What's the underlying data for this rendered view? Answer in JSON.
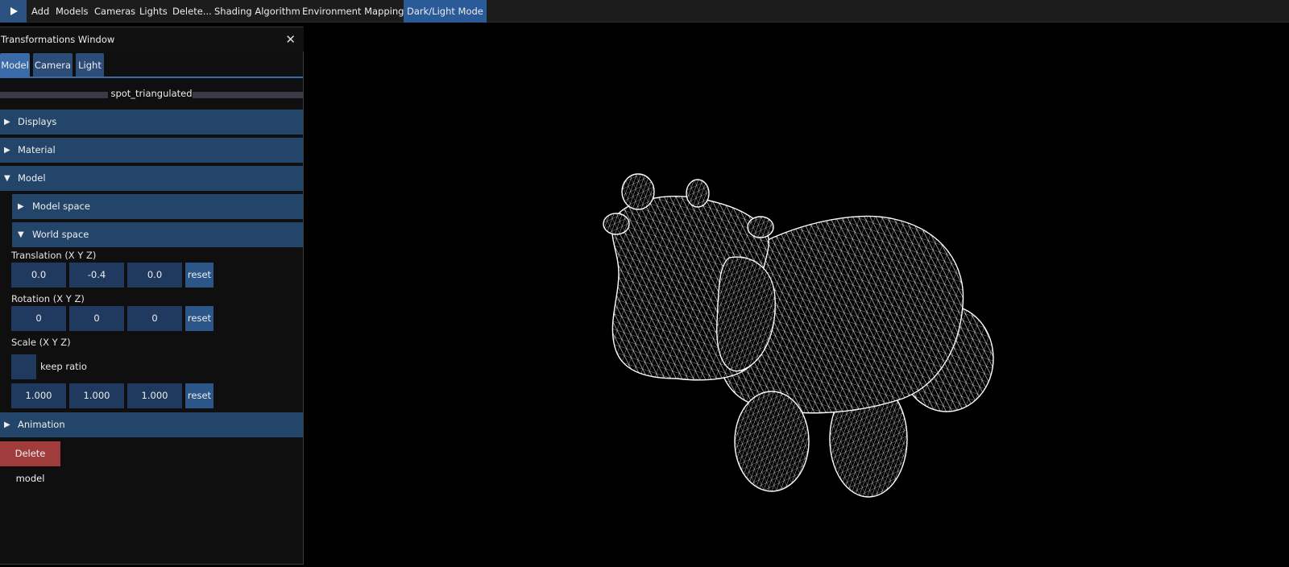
{
  "menubar": {
    "items": [
      "Add",
      "Models",
      "Cameras",
      "Lights",
      "Delete...",
      "Shading Algorithm",
      "Environment Mapping",
      "Dark/Light Mode"
    ],
    "play_icon": "play-icon"
  },
  "window": {
    "title": "Transformations Window",
    "close_icon": "close-icon",
    "tabs": [
      "Model",
      "Camera",
      "Light"
    ],
    "selected_model": "spot_triangulated",
    "sections": {
      "displays": "Displays",
      "material": "Material",
      "model": "Model",
      "model_space": "Model space",
      "world_space": "World space",
      "animation": "Animation"
    },
    "translation": {
      "label": "Translation (X Y Z)",
      "x": "0.0",
      "y": "-0.4",
      "z": "0.0"
    },
    "rotation": {
      "label": "Rotation (X Y Z)",
      "x": "0",
      "y": "0",
      "z": "0"
    },
    "scale": {
      "label": "Scale (X Y Z)",
      "keep_ratio": "keep ratio",
      "x": "1.000",
      "y": "1.000",
      "z": "1.000"
    },
    "reset_label": "reset",
    "delete_label": "Delete model"
  },
  "viewport": {
    "render_mode": "wireframe",
    "model_color": "#ffffff",
    "background": "#000000"
  }
}
